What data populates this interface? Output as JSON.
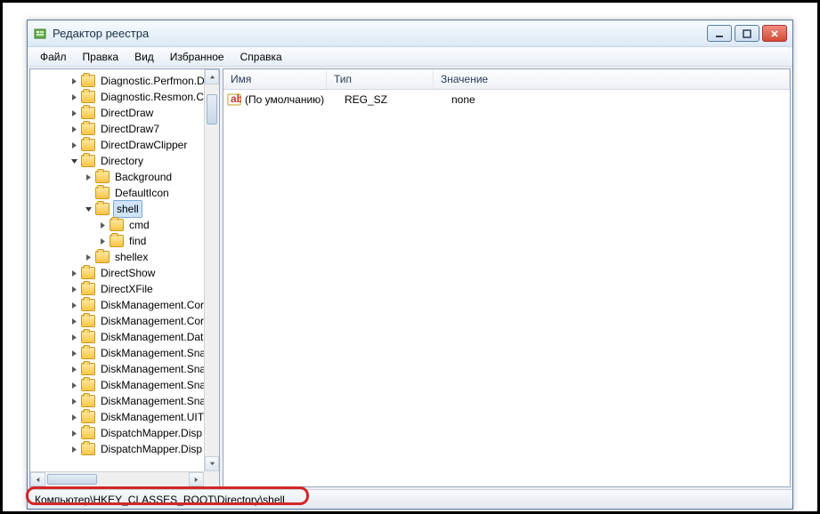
{
  "window": {
    "title": "Редактор реестра"
  },
  "menu": {
    "file": "Файл",
    "edit": "Правка",
    "view": "Вид",
    "favorites": "Избранное",
    "help": "Справка"
  },
  "tree": {
    "items": [
      {
        "indent": 0,
        "exp": "closed",
        "label": "Diagnostic.Perfmon.D"
      },
      {
        "indent": 0,
        "exp": "closed",
        "label": "Diagnostic.Resmon.C"
      },
      {
        "indent": 0,
        "exp": "closed",
        "label": "DirectDraw"
      },
      {
        "indent": 0,
        "exp": "closed",
        "label": "DirectDraw7"
      },
      {
        "indent": 0,
        "exp": "closed",
        "label": "DirectDrawClipper"
      },
      {
        "indent": 0,
        "exp": "open",
        "label": "Directory"
      },
      {
        "indent": 1,
        "exp": "closed",
        "label": "Background"
      },
      {
        "indent": 1,
        "exp": "none",
        "label": "DefaultIcon"
      },
      {
        "indent": 1,
        "exp": "open",
        "label": "shell",
        "selected": true
      },
      {
        "indent": 2,
        "exp": "closed",
        "label": "cmd"
      },
      {
        "indent": 2,
        "exp": "closed",
        "label": "find"
      },
      {
        "indent": 1,
        "exp": "closed",
        "label": "shellex"
      },
      {
        "indent": 0,
        "exp": "closed",
        "label": "DirectShow"
      },
      {
        "indent": 0,
        "exp": "closed",
        "label": "DirectXFile"
      },
      {
        "indent": 0,
        "exp": "closed",
        "label": "DiskManagement.Cor"
      },
      {
        "indent": 0,
        "exp": "closed",
        "label": "DiskManagement.Cor"
      },
      {
        "indent": 0,
        "exp": "closed",
        "label": "DiskManagement.Dat"
      },
      {
        "indent": 0,
        "exp": "closed",
        "label": "DiskManagement.Sna"
      },
      {
        "indent": 0,
        "exp": "closed",
        "label": "DiskManagement.Sna"
      },
      {
        "indent": 0,
        "exp": "closed",
        "label": "DiskManagement.Sna"
      },
      {
        "indent": 0,
        "exp": "closed",
        "label": "DiskManagement.Sna"
      },
      {
        "indent": 0,
        "exp": "closed",
        "label": "DiskManagement.UIT"
      },
      {
        "indent": 0,
        "exp": "closed",
        "label": "DispatchMapper.Disp"
      },
      {
        "indent": 0,
        "exp": "closed",
        "label": "DispatchMapper.Disp"
      }
    ]
  },
  "list": {
    "columns": {
      "name": "Имя",
      "type": "Тип",
      "value": "Значение"
    },
    "rows": [
      {
        "name": "(По умолчанию)",
        "type": "REG_SZ",
        "value": "none"
      }
    ]
  },
  "statusbar": {
    "path": "Компьютер\\HKEY_CLASSES_ROOT\\Directory\\shell"
  }
}
